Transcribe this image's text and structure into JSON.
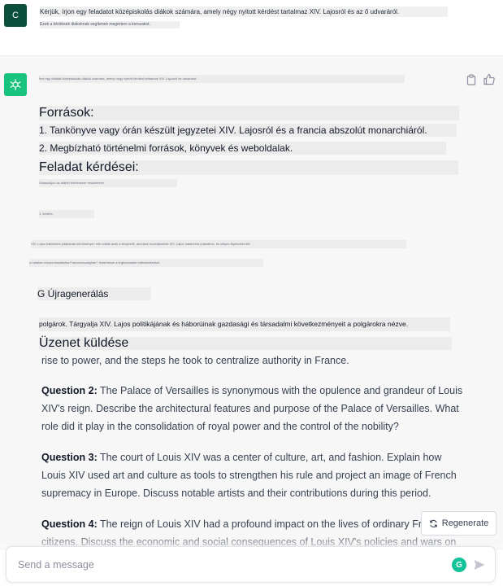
{
  "user_message": {
    "avatar_letter": "C",
    "prompt": "Kérjük, írjon egy feladatot középiskolás diákok számára, amely négy nyitott kérdést tartalmaz XIV. Lajosról és az ő udvaráról.",
    "sub": "Ezek a kérdések diákoknak segítenek megérteni a korszakot."
  },
  "assistant": {
    "garbled_intro": "Íme egy feladat középiskolás diákok számára, amely négy nyitott kérdést tartalmaz XIV. Lajosról és udvaráról:",
    "sources_heading": "Források:",
    "source_items": [
      "1. Tankönyve vagy órán készült jegyzetei XIV. Lajosról és a francia abszolút monarchiáról.",
      "2. Megbízható történelmi források, könyvek és weboldalak."
    ],
    "questions_heading": "Feladat kérdései:",
    "garbled_q_intro": "Válaszoljon az alábbi kérdésekre részletesen.",
    "garbled_q_sub": "1. kérdés:",
    "garbled_long1": "XIV. Lajos hatalomra jutásának körülményei: mik voltak azok a tényezők, amelyek hozzájárultak XIV. Lajos hatalomra jutásához, és milyen lépéseket tett",
    "garbled_long2": "a hatalom központosítására Franciaországban? Ismertesse a legfontosabb intézkedéseket.",
    "regen_overlay": "G Újragenerálás",
    "polgar_line": "polgárok. Tárgyalja XIV. Lajos politikájának és háborúinak gazdasági és társadalmi következményeit a polgárokra nézve.",
    "send_overlay": "Üzenet küldése",
    "para0": "rise to power, and the steps he took to centralize authority in France.",
    "questions": [
      {
        "label": "Question 2:",
        "text": " The Palace of Versailles is synonymous with the opulence and grandeur of Louis XIV's reign. Describe the architectural features and purpose of the Palace of Versailles. What role did it play in the consolidation of royal power and the control of the nobility?"
      },
      {
        "label": "Question 3:",
        "text": " The court of Louis XIV was a center of culture, art, and fashion. Explain how Louis XIV used art and culture as tools to strengthen his rule and project an image of French supremacy in Europe. Discuss notable artists and their contributions during this period."
      },
      {
        "label": "Question 4:",
        "text": " The reign of Louis XIV had a profound impact on the lives of ordinary French citizens. Discuss the economic and social consequences of Louis XIV's policies and wars on"
      }
    ]
  },
  "regenerate_button": {
    "label": "Regenerate"
  },
  "composer": {
    "placeholder": "Send a message"
  },
  "colors": {
    "bot_avatar": "#19c37d",
    "user_avatar": "#0b4f3c",
    "grammarly": "#15c39a"
  }
}
